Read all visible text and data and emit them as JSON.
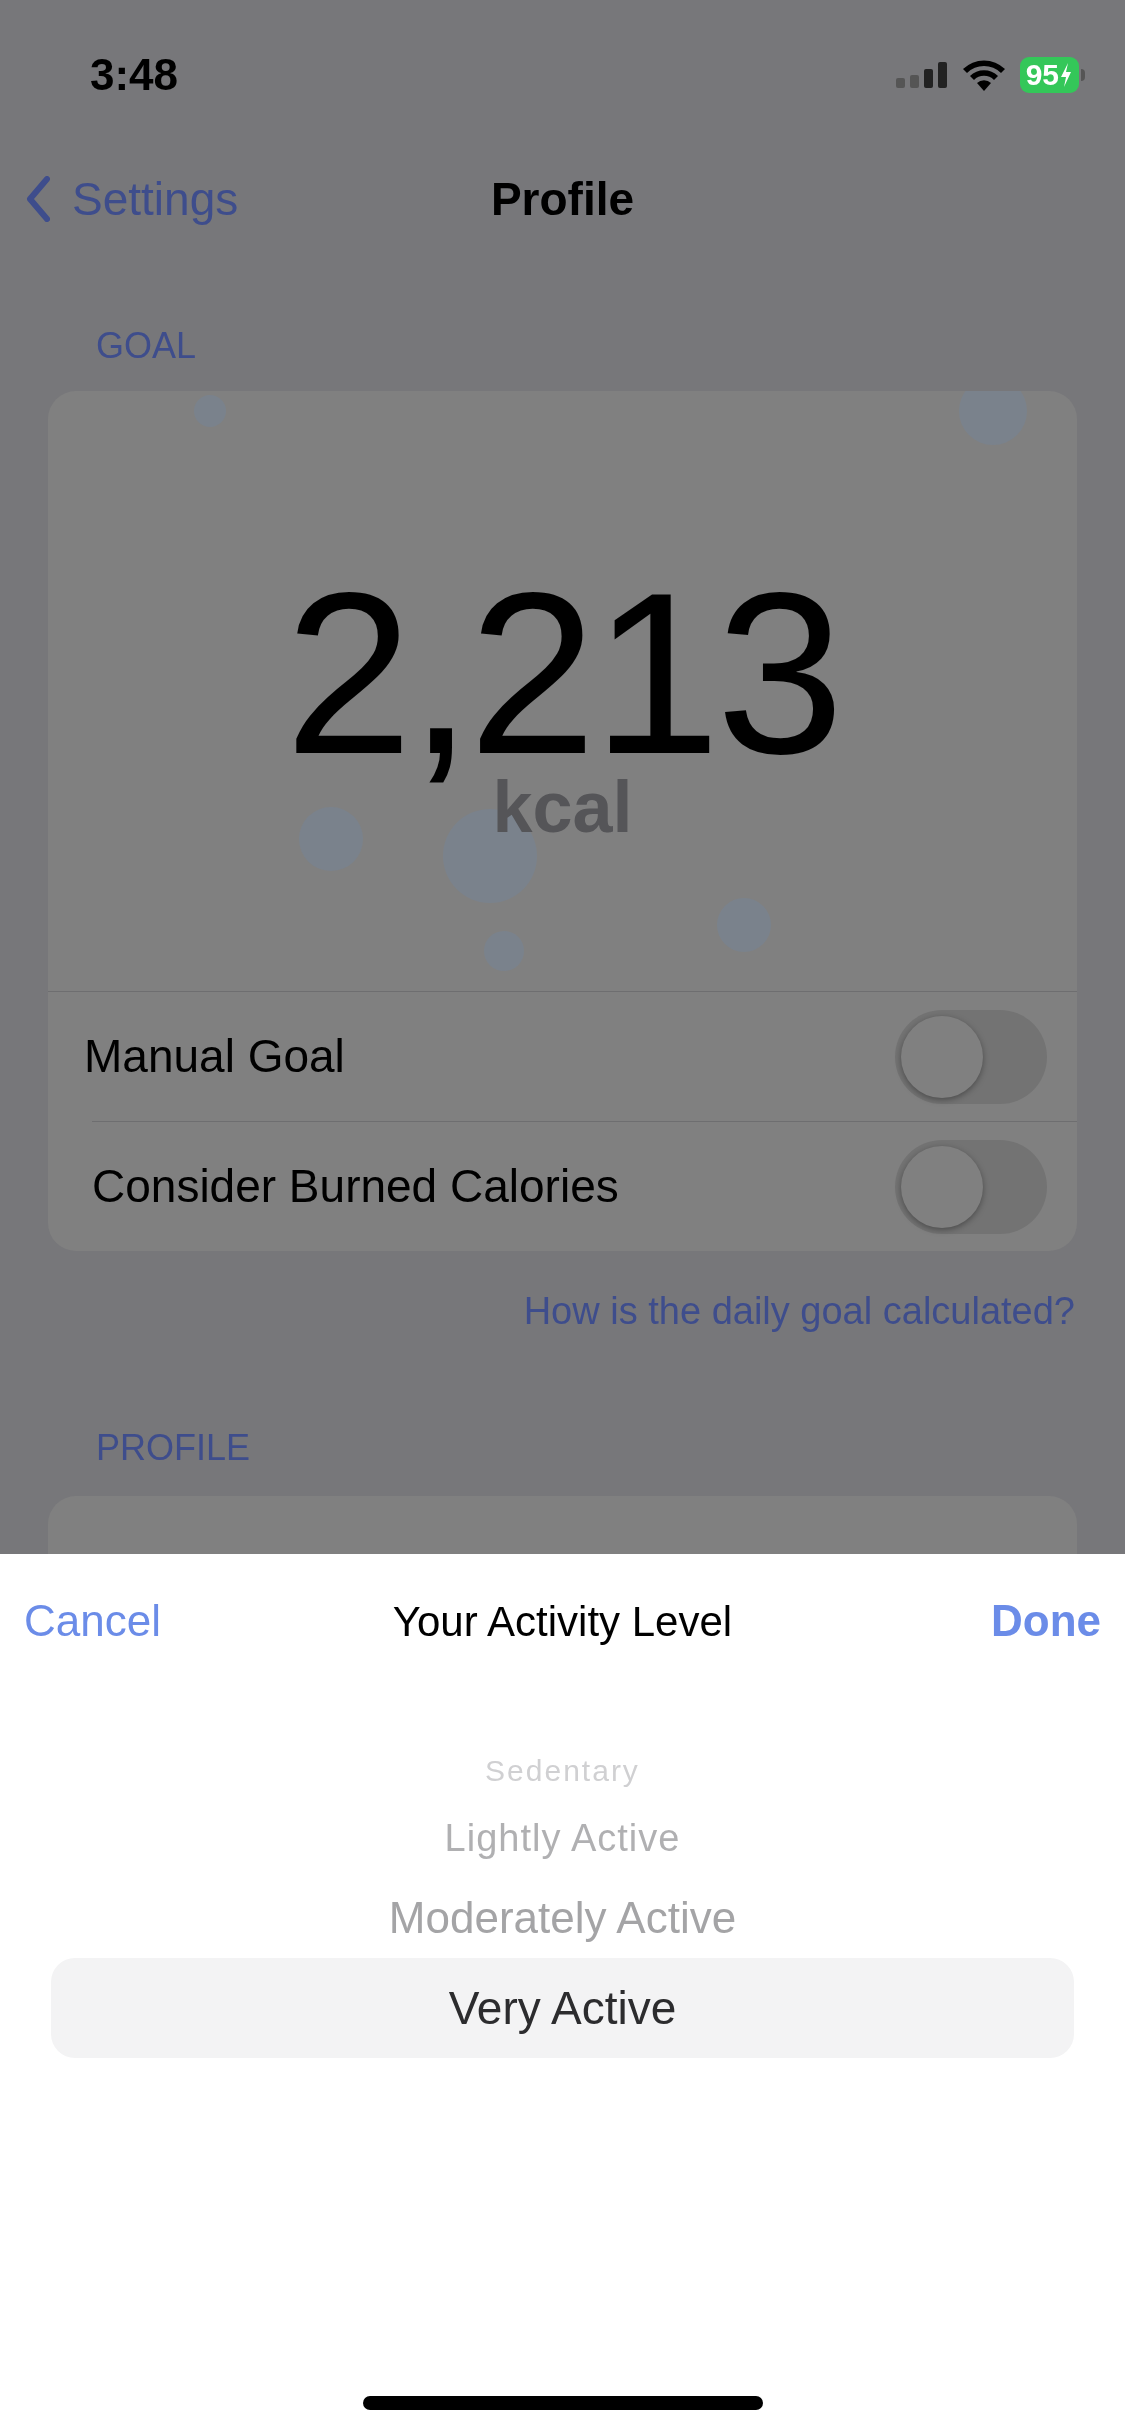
{
  "status_bar": {
    "time": "3:48",
    "battery": "95"
  },
  "nav": {
    "back": "Settings",
    "title": "Profile"
  },
  "goal": {
    "header": "GOAL",
    "value": "2,213",
    "unit": "kcal",
    "toggles": [
      {
        "label": "Manual Goal",
        "on": false
      },
      {
        "label": "Consider Burned Calories",
        "on": false
      }
    ],
    "link": "How is the daily goal calculated?"
  },
  "profile": {
    "header": "PROFILE"
  },
  "sheet": {
    "cancel": "Cancel",
    "title": "Your Activity Level",
    "done": "Done",
    "options": [
      {
        "label": "Sedentary",
        "selected": false
      },
      {
        "label": "Lightly Active",
        "selected": false
      },
      {
        "label": "Moderately Active",
        "selected": false
      },
      {
        "label": "Very Active",
        "selected": true
      }
    ]
  }
}
